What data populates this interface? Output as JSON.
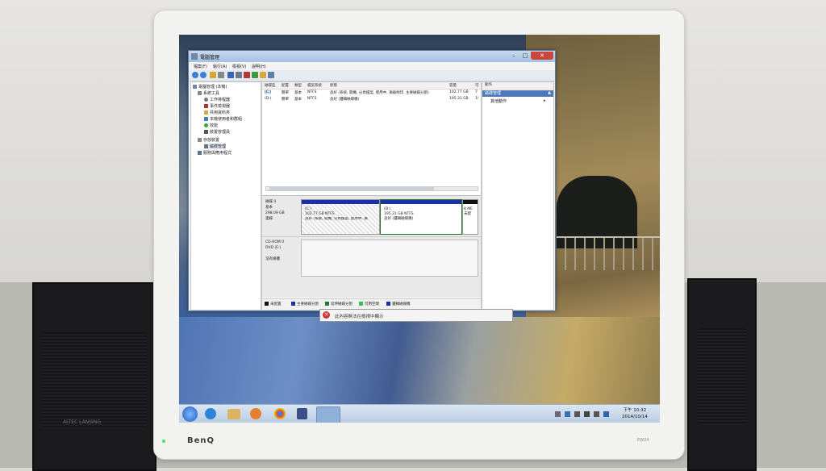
{
  "scene": {
    "brand": "BenQ",
    "model": "EW24",
    "speaker_label": "ALTEC LANSING"
  },
  "window": {
    "title": "電腦管理",
    "controls": {
      "minimize": "–",
      "maximize": "□",
      "close": "✕"
    },
    "menu": [
      "檔案(F)",
      "執行(A)",
      "檢視(V)",
      "說明(H)"
    ],
    "toolbar_icons": [
      "back-icon",
      "forward-icon",
      "up-icon",
      "properties-icon",
      "help-icon",
      "view-icon",
      "delete-icon",
      "check-icon",
      "folder-icon",
      "search-icon"
    ]
  },
  "tree": [
    {
      "label": "電腦管理 (本機)",
      "indent": 0,
      "icon": "computer-icon"
    },
    {
      "label": "系統工具",
      "indent": 1,
      "icon": "tools-icon"
    },
    {
      "label": "工作排程器",
      "indent": 2,
      "icon": "clock-icon"
    },
    {
      "label": "事件檢視器",
      "indent": 2,
      "icon": "event-icon"
    },
    {
      "label": "共用資料夾",
      "indent": 2,
      "icon": "folder-icon"
    },
    {
      "label": "本機使用者和群組",
      "indent": 2,
      "icon": "users-icon"
    },
    {
      "label": "效能",
      "indent": 2,
      "icon": "performance-icon"
    },
    {
      "label": "裝置管理員",
      "indent": 2,
      "icon": "device-icon"
    },
    {
      "label": "存放裝置",
      "indent": 1,
      "icon": "storage-icon"
    },
    {
      "label": "磁碟管理",
      "indent": 2,
      "icon": "disk-icon",
      "selected": true
    },
    {
      "label": "服務與應用程式",
      "indent": 1,
      "icon": "services-icon"
    }
  ],
  "volumes": {
    "headers": [
      "磁碟區",
      "配置",
      "類型",
      "檔案系統",
      "狀態",
      "容量",
      "可"
    ],
    "rows": [
      {
        "name": "(C:)",
        "layout": "簡單",
        "type": "基本",
        "fs": "NTFS",
        "status": "良好 (系統, 開機, 分頁檔案, 使用中, 損毀傾印, 主要磁碟分割)",
        "capacity": "102.77 GB",
        "free": "7"
      },
      {
        "name": "(D:)",
        "layout": "簡單",
        "type": "基本",
        "fs": "NTFS",
        "status": "良好 (邏輯磁碟機)",
        "capacity": "195.31 GB",
        "free": "1!"
      }
    ]
  },
  "disks": [
    {
      "name": "磁碟 0",
      "type": "基本",
      "size": "298.09 GB",
      "state": "連線",
      "partitions": [
        {
          "name": "(C:)",
          "size": "102.77 GB NTFS",
          "status": "良好 (系統, 開機, 分頁檔案, 使用中, 損",
          "style": "primary"
        },
        {
          "name": "(D:)",
          "size": "195.31 GB NTFS",
          "status": "良好 (邏輯磁碟機)",
          "style": "logical"
        },
        {
          "name": "",
          "size": "8 ME",
          "status": "未配",
          "style": "unallocated"
        }
      ]
    },
    {
      "name": "CD-ROM 0",
      "type": "DVD (E:)",
      "size": "",
      "state": "沒有媒體",
      "partitions": []
    }
  ],
  "legend": [
    {
      "label": "未配置",
      "color": "#111111"
    },
    {
      "label": "主要磁碟分割",
      "color": "#1a2fa8"
    },
    {
      "label": "延伸磁碟分割",
      "color": "#1e7a2e"
    },
    {
      "label": "可用空間",
      "color": "#3fbf5a"
    },
    {
      "label": "邏輯磁碟機",
      "color": "#1a2fa8"
    }
  ],
  "actions": {
    "header": "動作",
    "section": "磁碟管理",
    "item": "其他動作"
  },
  "popup": {
    "text": "此內容無法在檢視中顯示"
  },
  "taskbar": {
    "apps": [
      "explorer-icon",
      "ie-icon",
      "folder-icon",
      "media-player-icon",
      "chrome-icon",
      "antivirus-icon",
      "computer-management-icon"
    ],
    "time": "下午 10:32",
    "date": "2014/10/14"
  },
  "colors": {
    "accent": "#4b79b9",
    "primary_partition": "#1a2fa8",
    "close_button": "#c9473b"
  }
}
